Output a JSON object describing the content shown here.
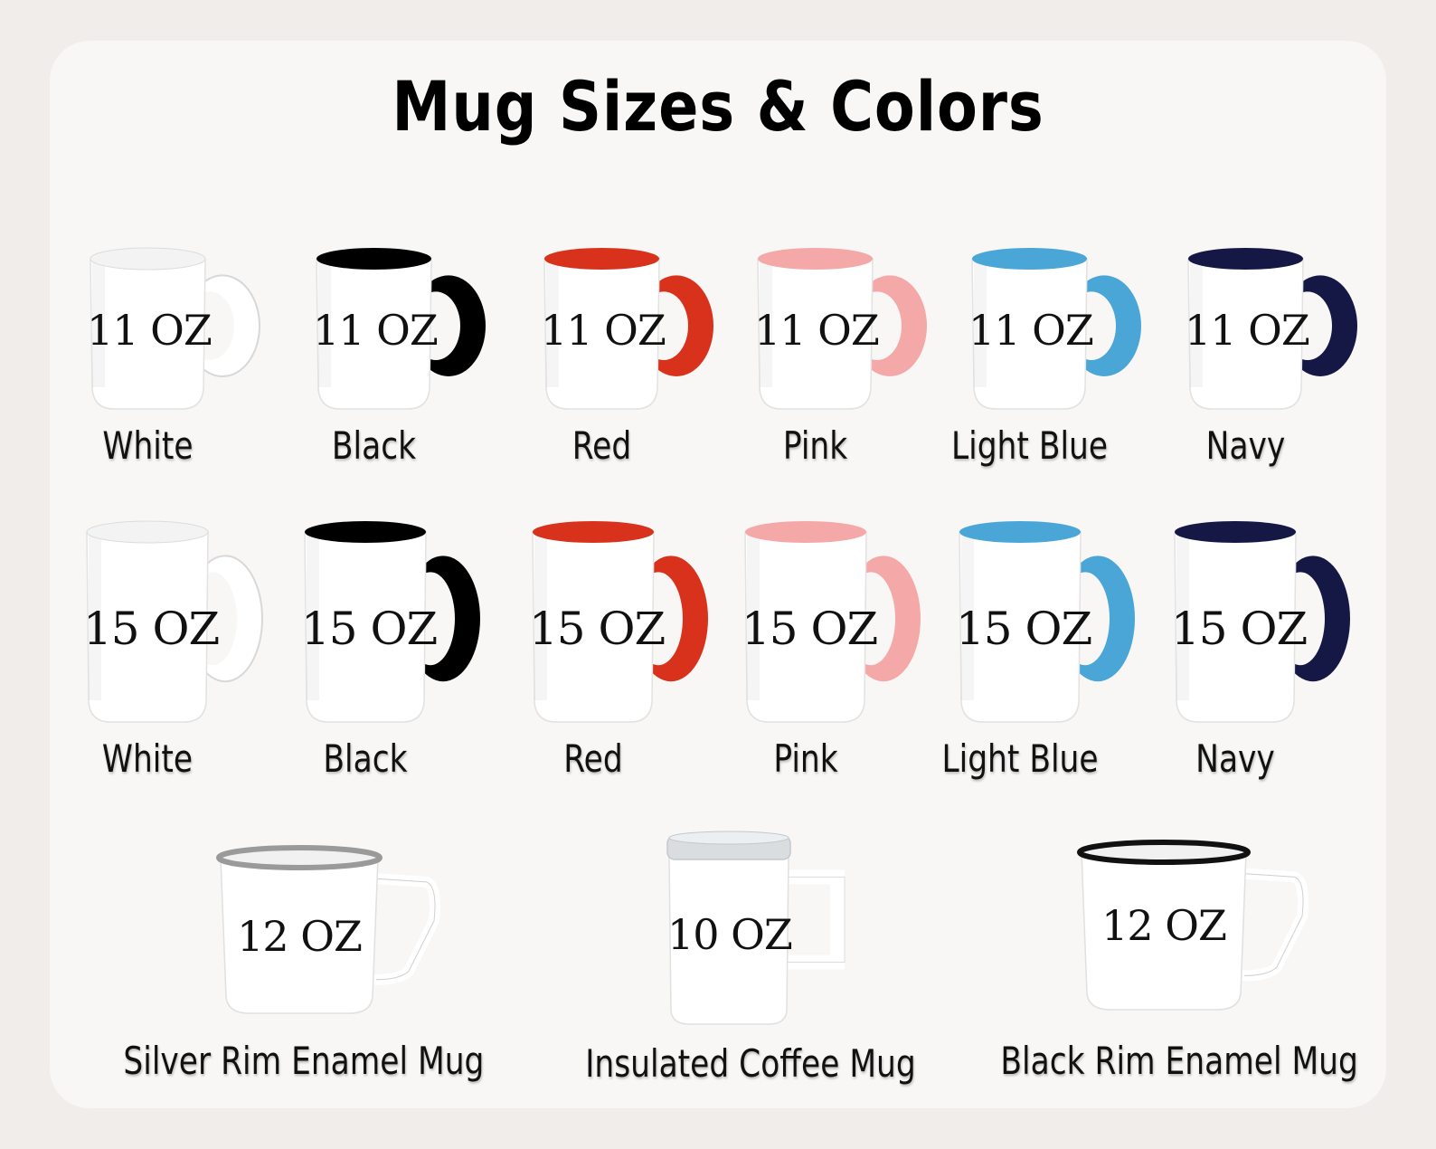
{
  "title": "Mug Sizes & Colors",
  "colors": {
    "white": "#ececec",
    "black": "#000000",
    "red": "#d8321c",
    "pink": "#f4a8a8",
    "light_blue": "#4aa6d6",
    "navy": "#151744"
  },
  "row_11oz": [
    {
      "size": "11 OZ",
      "label": "White",
      "accent": "#ececec"
    },
    {
      "size": "11 OZ",
      "label": "Black",
      "accent": "#000000"
    },
    {
      "size": "11 OZ",
      "label": "Red",
      "accent": "#d8321c"
    },
    {
      "size": "11 OZ",
      "label": "Pink",
      "accent": "#f4a8a8"
    },
    {
      "size": "11 OZ",
      "label": "Light Blue",
      "accent": "#4aa6d6"
    },
    {
      "size": "11 OZ",
      "label": "Navy",
      "accent": "#151744"
    }
  ],
  "row_15oz": [
    {
      "size": "15 OZ",
      "label": "White",
      "accent": "#ececec"
    },
    {
      "size": "15 OZ",
      "label": "Black",
      "accent": "#000000"
    },
    {
      "size": "15 OZ",
      "label": "Red",
      "accent": "#d8321c"
    },
    {
      "size": "15 OZ",
      "label": "Pink",
      "accent": "#f4a8a8"
    },
    {
      "size": "15 OZ",
      "label": "Light Blue",
      "accent": "#4aa6d6"
    },
    {
      "size": "15 OZ",
      "label": "Navy",
      "accent": "#151744"
    }
  ],
  "row_special": [
    {
      "size": "12 OZ",
      "label": "Silver Rim Enamel Mug",
      "rim": "#9a9a9a"
    },
    {
      "size": "10 OZ",
      "label": "Insulated Coffee Mug",
      "rim": "#d9dde0"
    },
    {
      "size": "12 OZ",
      "label": "Black Rim Enamel Mug",
      "rim": "#111111"
    }
  ]
}
